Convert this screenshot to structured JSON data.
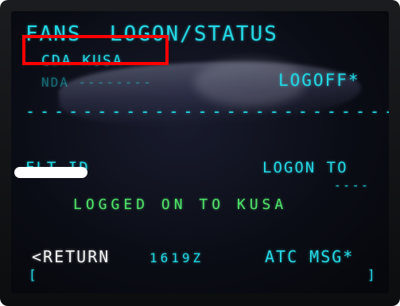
{
  "screen": {
    "title": "FANS  LOGON/STATUS",
    "cda_line": "CDA KUSA",
    "nda_line": "NDA --------",
    "logoff_label": "LOGOFF*",
    "separator": "----------------------------",
    "flt_id_label": "FLT ID",
    "logon_to_label": "LOGON TO",
    "logon_to_value": "----",
    "status_message": "LOGGED ON TO KUSA",
    "return_label": "<RETURN",
    "time": "1619Z",
    "atc_msg_label": "ATC MSG*",
    "scratchpad_left": "[",
    "scratchpad_right": "]"
  },
  "colors": {
    "cyan": "#24d7e3",
    "green": "#50e46a",
    "white": "#f2f2f2",
    "highlight": "#ff0000"
  }
}
